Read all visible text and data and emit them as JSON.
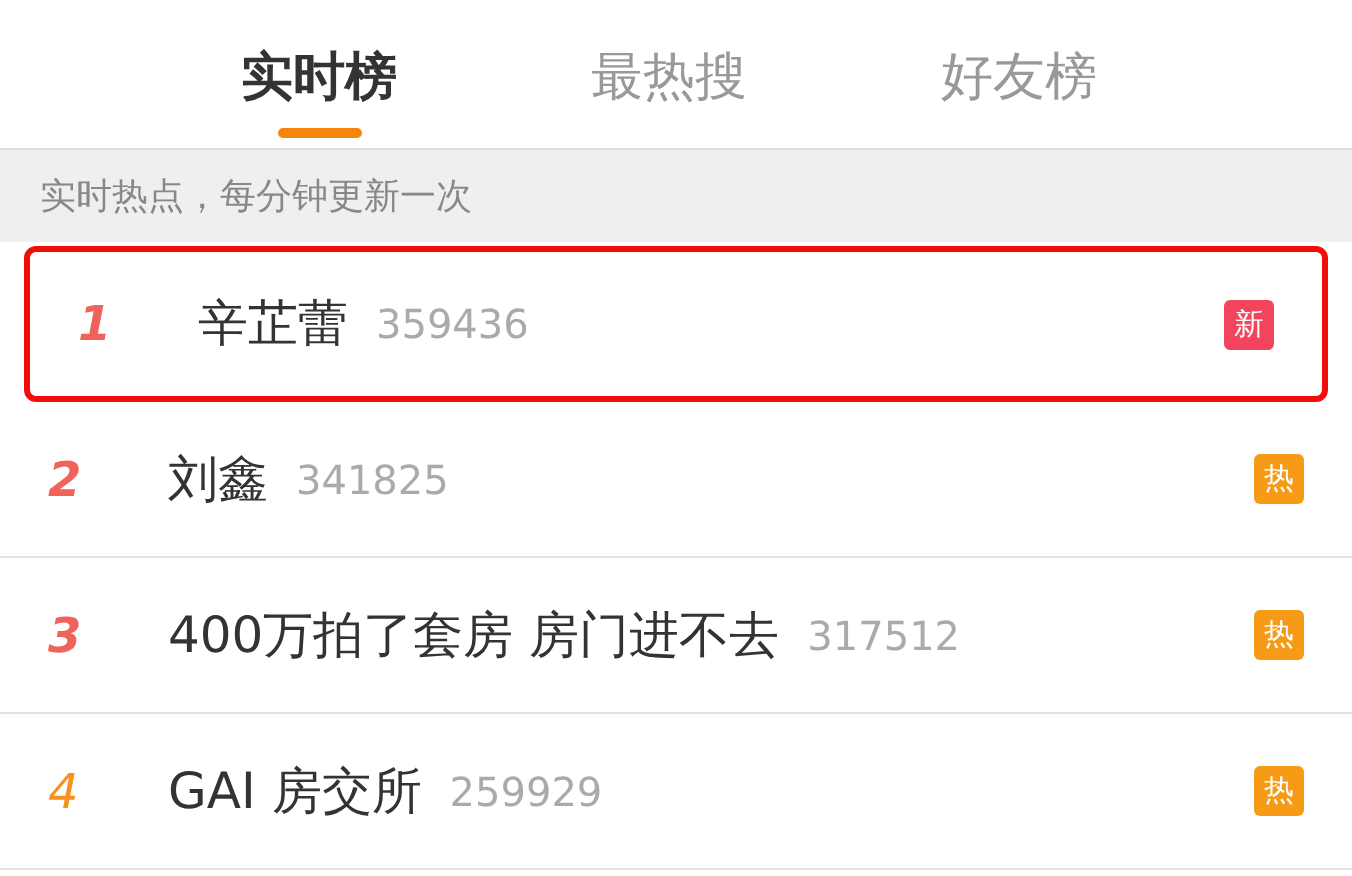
{
  "tabs": [
    {
      "label": "实时榜",
      "selected": true
    },
    {
      "label": "最热搜",
      "selected": false
    },
    {
      "label": "好友榜",
      "selected": false
    }
  ],
  "notice": "实时热点，每分钟更新一次",
  "items": [
    {
      "rank": "1",
      "color": "#f0625a",
      "title": "辛芷蕾",
      "count": "359436",
      "badge": {
        "kind": "new",
        "text": "新"
      },
      "highlighted": true
    },
    {
      "rank": "2",
      "color": "#f0625a",
      "title": "刘鑫",
      "count": "341825",
      "badge": {
        "kind": "hot",
        "text": "热"
      },
      "highlighted": false
    },
    {
      "rank": "3",
      "color": "#f0625a",
      "title": "400万拍了套房 房门进不去",
      "count": "317512",
      "badge": {
        "kind": "hot",
        "text": "热"
      },
      "highlighted": false
    },
    {
      "rank": "4",
      "color": "#f5921e",
      "title": "GAI 房交所",
      "count": "259929",
      "badge": {
        "kind": "hot",
        "text": "热"
      },
      "highlighted": false
    }
  ]
}
